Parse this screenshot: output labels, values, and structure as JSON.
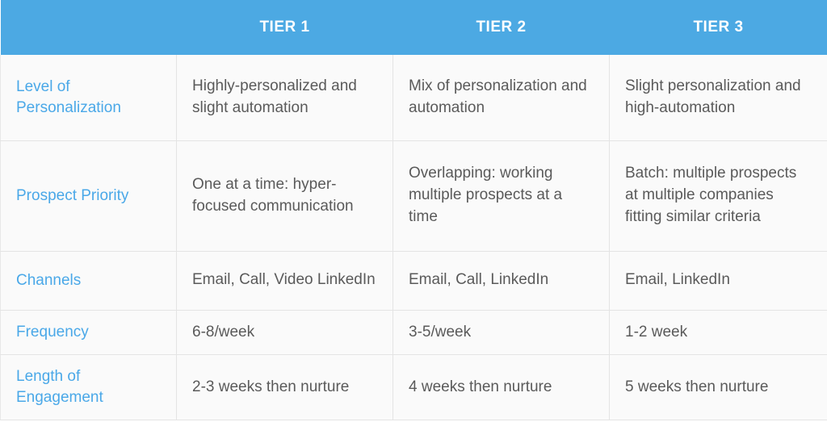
{
  "table": {
    "header": {
      "corner_label": "",
      "columns": [
        {
          "id": "tier-1",
          "label": "TIER 1"
        },
        {
          "id": "tier-2",
          "label": "TIER 2"
        },
        {
          "id": "tier-3",
          "label": "TIER 3"
        }
      ]
    },
    "rows": [
      {
        "id": "level-of-personalization",
        "label": "Level of Personalization",
        "cells": {
          "tier1": "Highly-personalized and slight automation",
          "tier2": "Mix of personalization and automation",
          "tier3": "Slight personalization and high-automation"
        }
      },
      {
        "id": "prospect-priority",
        "label": "Prospect Priority",
        "cells": {
          "tier1": "One at a time: hyper-focused communication",
          "tier2": "Overlapping: working multiple prospects at a time",
          "tier3": "Batch: multiple prospects at multiple companies fitting similar criteria"
        }
      },
      {
        "id": "channels",
        "label": "Channels",
        "cells": {
          "tier1": "Email, Call, Video LinkedIn",
          "tier2": "Email, Call, LinkedIn",
          "tier3": "Email, LinkedIn"
        }
      },
      {
        "id": "frequency",
        "label": "Frequency",
        "cells": {
          "tier1": "6-8/week",
          "tier2": "3-5/week",
          "tier3": "1-2 week"
        }
      },
      {
        "id": "length-of-engagement",
        "label": "Length of Engagement",
        "cells": {
          "tier1": "2-3 weeks then nurture",
          "tier2": "4 weeks then nurture",
          "tier3": "5 weeks then nurture"
        }
      }
    ]
  },
  "colors": {
    "header_background": "#4ca9e3",
    "header_text": "#ffffff",
    "row_label_text": "#4aa8e8",
    "cell_text": "#5a5a5a",
    "cell_background": "#fafafa",
    "border": "#e4e4e4"
  }
}
